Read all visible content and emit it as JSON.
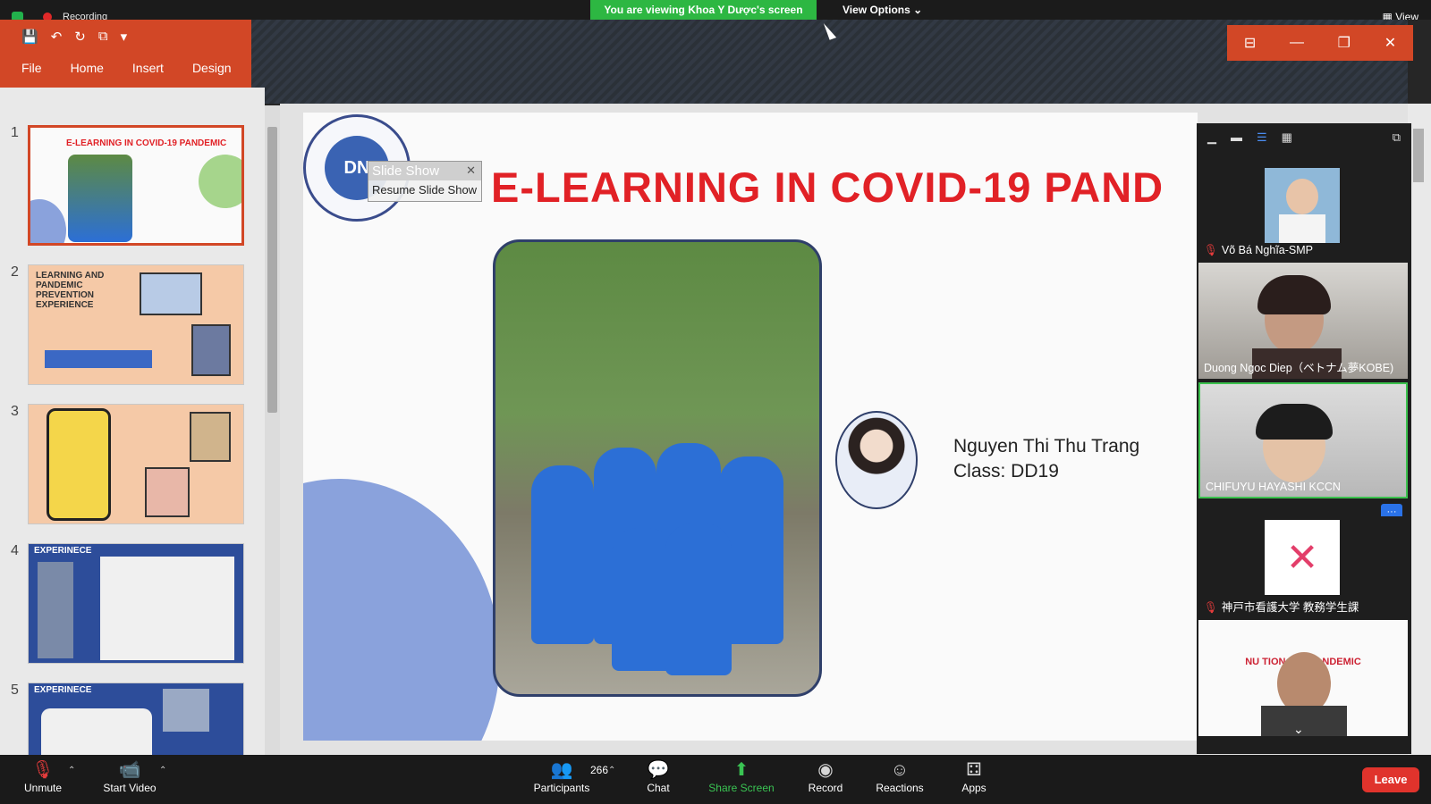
{
  "top_bar": {
    "recording_label": "Recording",
    "viewing_banner": "You are viewing Khoa Y Dược's screen",
    "view_options": "View Options ⌄",
    "view_right": "View"
  },
  "ppt": {
    "tabs": [
      "File",
      "Home",
      "Insert",
      "Design"
    ],
    "qat_icons": [
      "save-icon",
      "undo-icon",
      "redo-icon",
      "slideshow-icon",
      "more-icon"
    ]
  },
  "thumbnails": [
    {
      "num": "1",
      "text": "E-LEARNING IN COVID-19 PANDEMIC"
    },
    {
      "num": "2",
      "text": "LEARNING AND PANDEMIC PREVENTION EXPERIENCE"
    },
    {
      "num": "3",
      "text": ""
    },
    {
      "num": "4",
      "text": "EXPERINECE"
    },
    {
      "num": "5",
      "text": "EXPERINECE"
    }
  ],
  "slide": {
    "title": "E-LEARNING IN COVID-19 PAND",
    "name_line1": "Nguyen Thi Thu Trang",
    "name_line2": "Class: DD19",
    "slideshow_popup": "Slide Show",
    "resume": "Resume Slide Show",
    "logo_text": "DN"
  },
  "gallery": {
    "participants": [
      {
        "name": "Võ Bá Nghĩa-SMP",
        "muted": true
      },
      {
        "name": "Duong Ngoc Diep（ベトナム夢KOBE)",
        "muted": false
      },
      {
        "name": "CHIFUYU HAYASHI  KCCN",
        "muted": false
      },
      {
        "name": "神戸市看護大学 教務学生課",
        "muted": true
      }
    ],
    "last_tile_text": "NU   TION  DURIN   NDEMIC",
    "more_button": "···"
  },
  "toolbar": {
    "unmute": "Unmute",
    "start_video": "Start Video",
    "participants": "Participants",
    "participants_count": "266",
    "chat": "Chat",
    "share_screen": "Share Screen",
    "record": "Record",
    "reactions": "Reactions",
    "apps": "Apps",
    "leave": "Leave"
  }
}
